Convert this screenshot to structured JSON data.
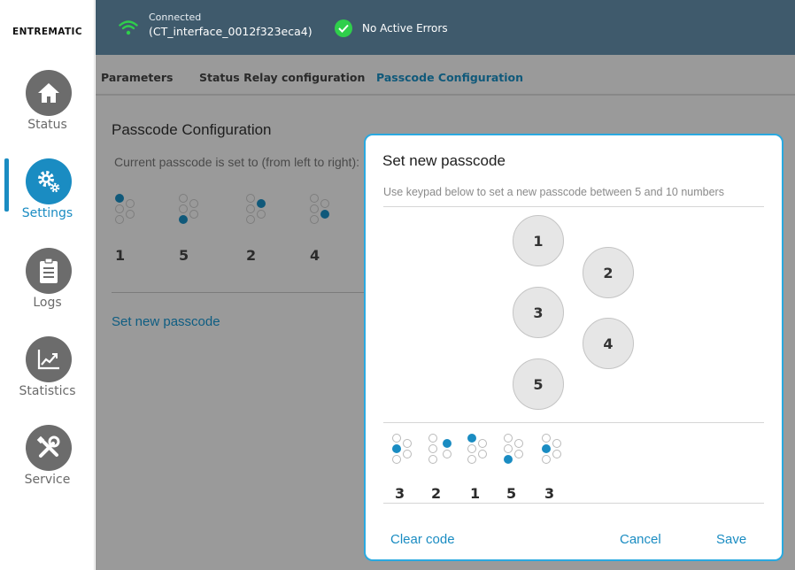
{
  "sidebar": {
    "logo": "ENTREMATIC",
    "items": [
      {
        "id": "status",
        "label": "Status",
        "icon": "home-icon",
        "active": false
      },
      {
        "id": "settings",
        "label": "Settings",
        "icon": "gears-icon",
        "active": true
      },
      {
        "id": "logs",
        "label": "Logs",
        "icon": "clipboard-icon",
        "active": false
      },
      {
        "id": "statistics",
        "label": "Statistics",
        "icon": "chart-icon",
        "active": false
      },
      {
        "id": "service",
        "label": "Service",
        "icon": "tools-icon",
        "active": false
      }
    ]
  },
  "header": {
    "connection_label": "Connected",
    "connection_name": "(CT_interface_0012f323eca4)",
    "error_status": "No Active Errors",
    "wifi_icon": "wifi-icon",
    "check_icon": "check-icon"
  },
  "tabs": [
    {
      "label": "Parameters",
      "active": false
    },
    {
      "label": "Status Relay configuration",
      "active": false
    },
    {
      "label": "Passcode Configuration",
      "active": true
    }
  ],
  "content": {
    "title": "Passcode Configuration",
    "description": "Current passcode is set to (from left to right):",
    "current_passcode": [
      "1",
      "5",
      "2",
      "4"
    ],
    "set_link": "Set new passcode"
  },
  "dialog": {
    "title": "Set new passcode",
    "hint": "Use keypad below to set a new passcode between 5 and 10 numbers",
    "keys": [
      "1",
      "2",
      "3",
      "4",
      "5"
    ],
    "entered_code": [
      "3",
      "2",
      "1",
      "5",
      "3"
    ],
    "clear_label": "Clear code",
    "cancel_label": "Cancel",
    "save_label": "Save"
  },
  "colors": {
    "accent": "#1a8cc2",
    "topbar": "#3f5a6c",
    "success": "#2fcf4b",
    "dialog_border": "#29a9e0"
  }
}
